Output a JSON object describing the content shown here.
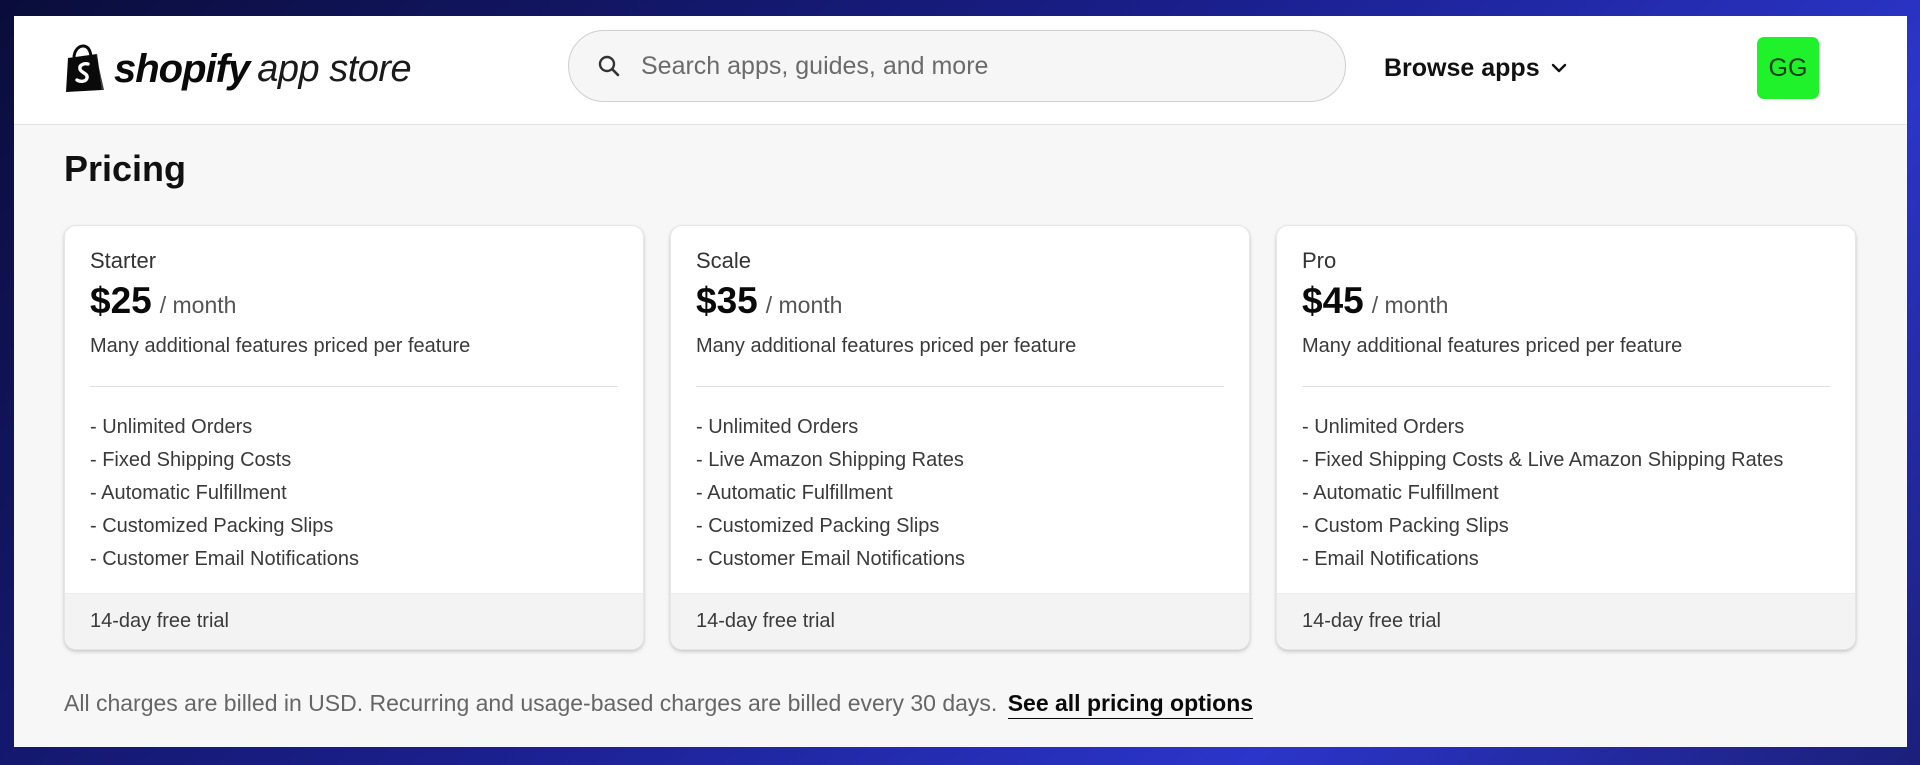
{
  "header": {
    "logo_bold": "shopify",
    "logo_light": "app store",
    "search_placeholder": "Search apps, guides, and more",
    "browse_label": "Browse apps",
    "avatar_initials": "GG",
    "avatar_color": "#1ff22a"
  },
  "pricing": {
    "title": "Pricing",
    "plans": [
      {
        "name": "Starter",
        "price": "$25",
        "period": "/ month",
        "description": "Many additional features priced per feature",
        "features": [
          "- Unlimited Orders",
          "- Fixed Shipping Costs",
          "- Automatic Fulfillment",
          "- Customized Packing Slips",
          "- Customer Email Notifications"
        ],
        "trial": "14-day free trial"
      },
      {
        "name": "Scale",
        "price": "$35",
        "period": "/ month",
        "description": "Many additional features priced per feature",
        "features": [
          "- Unlimited Orders",
          "- Live Amazon Shipping Rates",
          "- Automatic Fulfillment",
          "- Customized Packing Slips",
          "- Customer Email Notifications"
        ],
        "trial": "14-day free trial"
      },
      {
        "name": "Pro",
        "price": "$45",
        "period": "/ month",
        "description": "Many additional features priced per feature",
        "features": [
          "- Unlimited Orders",
          "- Fixed Shipping Costs & Live Amazon Shipping Rates",
          "- Automatic Fulfillment",
          "- Custom Packing Slips",
          "- Email Notifications"
        ],
        "trial": "14-day free trial"
      }
    ],
    "billing_note": "All charges are billed in USD. Recurring and usage-based charges are billed every 30 days.",
    "see_all_link": "See all pricing options"
  }
}
